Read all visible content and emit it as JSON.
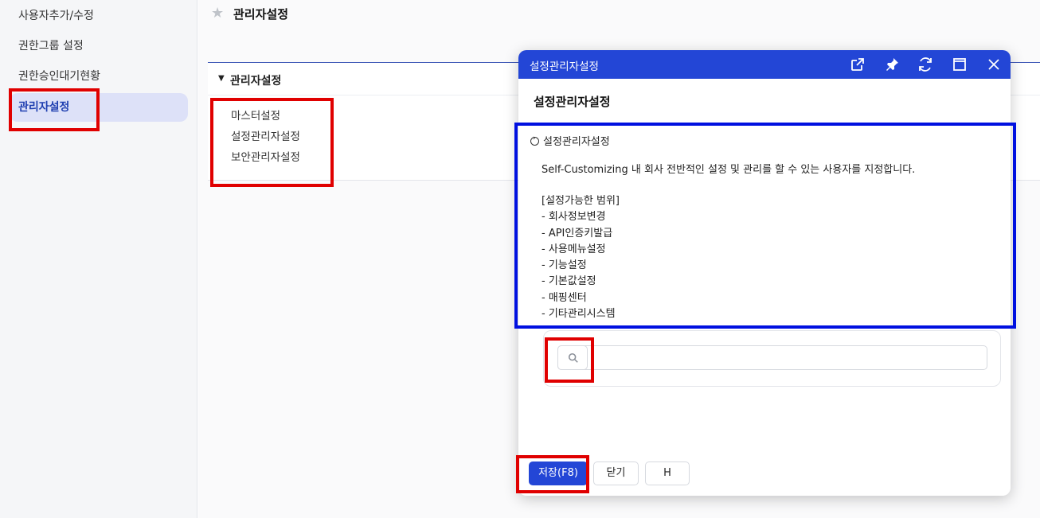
{
  "sidebar": {
    "items": [
      {
        "label": "사용자추가/수정"
      },
      {
        "label": "권한그룹 설정"
      },
      {
        "label": "권한승인대기현황"
      },
      {
        "label": "관리자설정"
      }
    ]
  },
  "page": {
    "title": "관리자설정",
    "section_label": "관리자설정",
    "menu_links": [
      "마스터설정",
      "설정관리자설정",
      "보안관리자설정"
    ]
  },
  "dialog": {
    "window_title": "설정관리자설정",
    "heading": "설정관리자설정",
    "desc_title": "설정관리자설정",
    "desc_lines": [
      "Self-Customizing 내 회사 전반적인 설정 및 관리를 할 수 있는 사용자를 지정합니다.",
      "[설정가능한 범위]",
      "- 회사정보변경",
      "- API인증키발급",
      "- 사용메뉴설정",
      "- 기능설정",
      "- 기본값설정",
      "- 매핑센터",
      "- 기타관리시스템"
    ],
    "search": {
      "placeholder": ""
    },
    "buttons": {
      "save": "저장(F8)",
      "close": "닫기",
      "h": "H"
    },
    "titlebar_icons": [
      "external-link-icon",
      "pin-icon",
      "refresh-icon",
      "maximize-icon",
      "close-icon"
    ]
  },
  "colors": {
    "accent": "#2346d6",
    "highlight_red": "#e00000",
    "highlight_blue": "#0010e0",
    "active_bg": "#dde1f8"
  }
}
